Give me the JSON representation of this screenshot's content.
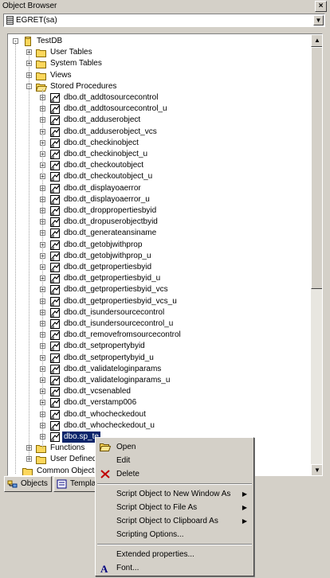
{
  "window": {
    "title": "Object Browser",
    "close_label": "×"
  },
  "connection": {
    "value": "EGRET(sa)"
  },
  "tree": {
    "root": "TestDB",
    "folders": [
      "User Tables",
      "System Tables",
      "Views",
      "Stored Procedures"
    ],
    "procedures": [
      "dbo.dt_addtosourcecontrol",
      "dbo.dt_addtosourcecontrol_u",
      "dbo.dt_adduserobject",
      "dbo.dt_adduserobject_vcs",
      "dbo.dt_checkinobject",
      "dbo.dt_checkinobject_u",
      "dbo.dt_checkoutobject",
      "dbo.dt_checkoutobject_u",
      "dbo.dt_displayoaerror",
      "dbo.dt_displayoaerror_u",
      "dbo.dt_droppropertiesbyid",
      "dbo.dt_dropuserobjectbyid",
      "dbo.dt_generateansiname",
      "dbo.dt_getobjwithprop",
      "dbo.dt_getobjwithprop_u",
      "dbo.dt_getpropertiesbyid",
      "dbo.dt_getpropertiesbyid_u",
      "dbo.dt_getpropertiesbyid_vcs",
      "dbo.dt_getpropertiesbyid_vcs_u",
      "dbo.dt_isundersourcecontrol",
      "dbo.dt_isundersourcecontrol_u",
      "dbo.dt_removefromsourcecontrol",
      "dbo.dt_setpropertybyid",
      "dbo.dt_setpropertybyid_u",
      "dbo.dt_validateloginparams",
      "dbo.dt_validateloginparams_u",
      "dbo.dt_vcsenabled",
      "dbo.dt_verstamp006",
      "dbo.dt_whocheckedout",
      "dbo.dt_whocheckedout_u",
      "dbo.sp_te"
    ],
    "after_folders": [
      "Functions",
      "User Defined"
    ],
    "cut_off": "Common Objects"
  },
  "tabs": [
    {
      "label": "Objects",
      "active": true
    },
    {
      "label": "Templat",
      "active": false
    }
  ],
  "context_menu": {
    "items": [
      {
        "label": "Open",
        "icon": "open-folder-icon"
      },
      {
        "label": "Edit",
        "icon": ""
      },
      {
        "label": "Delete",
        "icon": "delete-x-icon"
      }
    ],
    "script_items": [
      {
        "label": "Script Object to New Window As",
        "submenu": true
      },
      {
        "label": "Script Object to File As",
        "submenu": true
      },
      {
        "label": "Script Object to Clipboard As",
        "submenu": true
      },
      {
        "label": "Scripting Options...",
        "submenu": false
      }
    ],
    "bottom_items": [
      {
        "label": "Extended properties...",
        "icon": ""
      },
      {
        "label": "Font...",
        "icon": "font-a-icon"
      }
    ]
  },
  "colors": {
    "selection": "#0a246a",
    "folder": "#fcd75c",
    "chrome": "#d4d0c8"
  }
}
